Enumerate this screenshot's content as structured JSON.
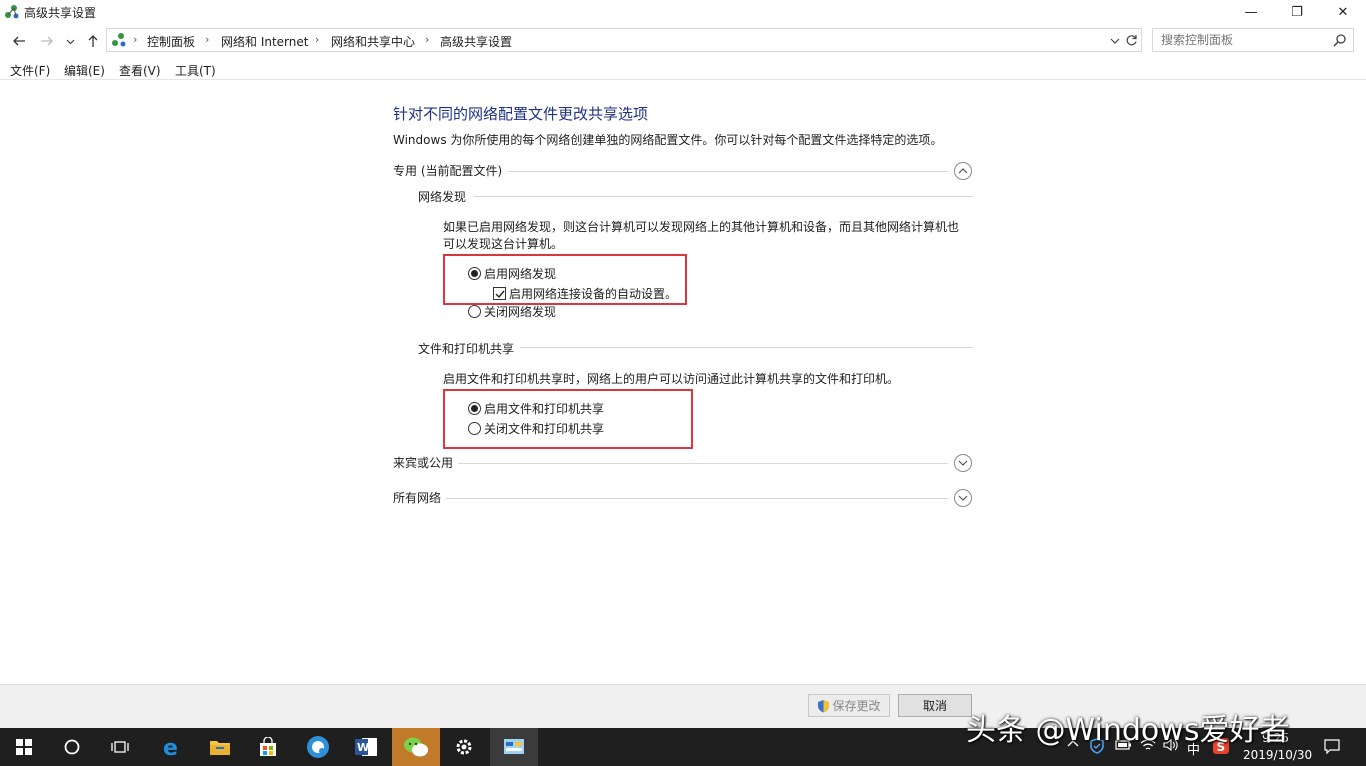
{
  "window": {
    "title": "高级共享设置",
    "controls": {
      "minimize": "—",
      "restore": "❐",
      "close": "✕"
    }
  },
  "address": {
    "crumbs": [
      "控制面板",
      "网络和 Internet",
      "网络和共享中心",
      "高级共享设置"
    ],
    "search_placeholder": "搜索控制面板"
  },
  "menu": [
    "文件(F)",
    "编辑(E)",
    "查看(V)",
    "工具(T)"
  ],
  "content": {
    "heading": "针对不同的网络配置文件更改共享选项",
    "intro": "Windows 为你所使用的每个网络创建单独的网络配置文件。你可以针对每个配置文件选择特定的选项。",
    "private_section": "专用 (当前配置文件)",
    "network_discovery": {
      "title": "网络发现",
      "desc_line1": "如果已启用网络发现，则这台计算机可以发现网络上的其他计算机和设备，而且其他网络计算机也",
      "desc_line2": "可以发现这台计算机。",
      "opt_on": "启用网络发现",
      "opt_auto": "启用网络连接设备的自动设置。",
      "opt_off": "关闭网络发现",
      "selected": "on",
      "auto_checked": true
    },
    "file_sharing": {
      "title": "文件和打印机共享",
      "desc": "启用文件和打印机共享时，网络上的用户可以访问通过此计算机共享的文件和打印机。",
      "opt_on": "启用文件和打印机共享",
      "opt_off": "关闭文件和打印机共享",
      "selected": "on"
    },
    "guest_section": "来宾或公用",
    "all_section": "所有网络"
  },
  "footer": {
    "save_label": "保存更改",
    "cancel_label": "取消"
  },
  "watermark": "头条 @Windows爱好者",
  "taskbar": {
    "ime": "中",
    "time": "9:25",
    "date": "2019/10/30"
  },
  "colors": {
    "heading": "#1e3287",
    "highlight_box": "#d9363e",
    "taskbar": "#1f1f1f"
  }
}
